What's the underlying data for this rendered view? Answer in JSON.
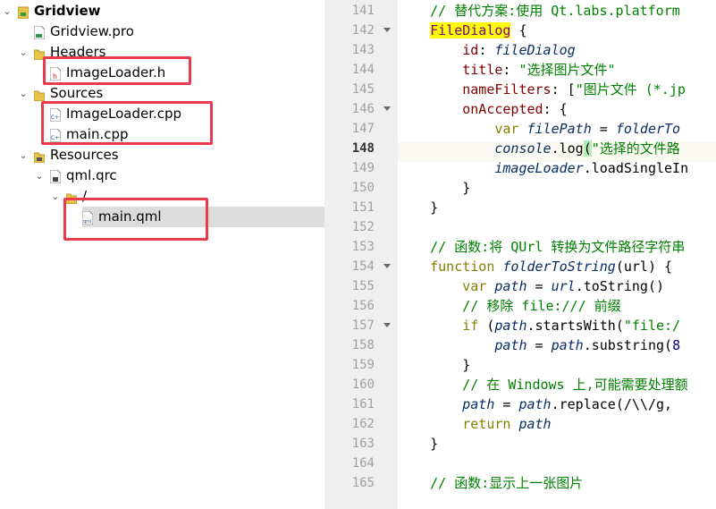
{
  "project_tree": {
    "items": [
      {
        "name": "tree-item-gridview",
        "label": "Gridview",
        "level": 0,
        "expanded": true,
        "icon": "project-folder-icon",
        "bold": true
      },
      {
        "name": "tree-item-gridview-pro",
        "label": "Gridview.pro",
        "level": 1,
        "expanded": null,
        "icon": "pro-file-icon"
      },
      {
        "name": "tree-item-headers",
        "label": "Headers",
        "level": 1,
        "expanded": true,
        "icon": "folder-icon"
      },
      {
        "name": "tree-item-imageloader-h",
        "label": "ImageLoader.h",
        "level": 2,
        "expanded": null,
        "icon": "header-file-icon"
      },
      {
        "name": "tree-item-sources",
        "label": "Sources",
        "level": 1,
        "expanded": true,
        "icon": "folder-icon"
      },
      {
        "name": "tree-item-imageloader-cpp",
        "label": "ImageLoader.cpp",
        "level": 2,
        "expanded": null,
        "icon": "cpp-file-icon"
      },
      {
        "name": "tree-item-main-cpp",
        "label": "main.cpp",
        "level": 2,
        "expanded": null,
        "icon": "cpp-file-icon"
      },
      {
        "name": "tree-item-resources",
        "label": "Resources",
        "level": 1,
        "expanded": true,
        "icon": "resource-folder-icon"
      },
      {
        "name": "tree-item-qml-qrc",
        "label": "qml.qrc",
        "level": 2,
        "expanded": true,
        "icon": "qrc-file-icon"
      },
      {
        "name": "tree-item-root-prefix",
        "label": "/",
        "level": 3,
        "expanded": true,
        "icon": "folder-icon"
      },
      {
        "name": "tree-item-main-qml",
        "label": "main.qml",
        "level": 4,
        "expanded": null,
        "icon": "qml-file-icon",
        "selected": true
      }
    ]
  },
  "editor": {
    "current_line": 148,
    "lines": [
      {
        "num": 141,
        "fold": false,
        "code": [
          {
            "t": "    // 替代方案:使用 Qt.labs.platform",
            "c": "cm"
          }
        ]
      },
      {
        "num": 142,
        "fold": true,
        "code": [
          {
            "t": "    "
          },
          {
            "t": "FileDialog",
            "c": "ty hlword"
          },
          {
            "t": " {"
          }
        ]
      },
      {
        "num": 143,
        "fold": false,
        "code": [
          {
            "t": "        "
          },
          {
            "t": "id",
            "c": "prop"
          },
          {
            "t": ": "
          },
          {
            "t": "fileDialog",
            "c": "id"
          }
        ]
      },
      {
        "num": 144,
        "fold": false,
        "code": [
          {
            "t": "        "
          },
          {
            "t": "title",
            "c": "prop"
          },
          {
            "t": ": "
          },
          {
            "t": "\"选择图片文件\"",
            "c": "str"
          }
        ]
      },
      {
        "num": 145,
        "fold": false,
        "code": [
          {
            "t": "        "
          },
          {
            "t": "nameFilters",
            "c": "prop"
          },
          {
            "t": ": ["
          },
          {
            "t": "\"图片文件 (*.jp",
            "c": "str"
          }
        ]
      },
      {
        "num": 146,
        "fold": true,
        "code": [
          {
            "t": "        "
          },
          {
            "t": "onAccepted",
            "c": "prop"
          },
          {
            "t": ": {"
          }
        ]
      },
      {
        "num": 147,
        "fold": false,
        "code": [
          {
            "t": "            "
          },
          {
            "t": "var",
            "c": "kw"
          },
          {
            "t": " "
          },
          {
            "t": "filePath",
            "c": "id"
          },
          {
            "t": " = "
          },
          {
            "t": "folderTo",
            "c": "id"
          }
        ]
      },
      {
        "num": 148,
        "fold": false,
        "code": [
          {
            "t": "            "
          },
          {
            "t": "console",
            "c": "id"
          },
          {
            "t": ".log"
          },
          {
            "t": "(",
            "c": "bm"
          },
          {
            "t": "\"选择的文件路",
            "c": "str"
          }
        ]
      },
      {
        "num": 149,
        "fold": false,
        "code": [
          {
            "t": "            "
          },
          {
            "t": "imageLoader",
            "c": "id"
          },
          {
            "t": ".loadSingleIn"
          }
        ]
      },
      {
        "num": 150,
        "fold": false,
        "code": [
          {
            "t": "        }"
          }
        ]
      },
      {
        "num": 151,
        "fold": false,
        "code": [
          {
            "t": "    }"
          }
        ]
      },
      {
        "num": 152,
        "fold": false,
        "code": [
          {
            "t": ""
          }
        ]
      },
      {
        "num": 153,
        "fold": false,
        "code": [
          {
            "t": "    // 函数:将 QUrl 转换为文件路径字符串",
            "c": "cm"
          }
        ]
      },
      {
        "num": 154,
        "fold": true,
        "code": [
          {
            "t": "    "
          },
          {
            "t": "function",
            "c": "kw"
          },
          {
            "t": " "
          },
          {
            "t": "folderToString",
            "c": "id"
          },
          {
            "t": "(url) {"
          }
        ]
      },
      {
        "num": 155,
        "fold": false,
        "code": [
          {
            "t": "        "
          },
          {
            "t": "var",
            "c": "kw"
          },
          {
            "t": " "
          },
          {
            "t": "path",
            "c": "id"
          },
          {
            "t": " = "
          },
          {
            "t": "url",
            "c": "id"
          },
          {
            "t": ".toString()"
          }
        ]
      },
      {
        "num": 156,
        "fold": false,
        "code": [
          {
            "t": "        // 移除 file:/// 前缀",
            "c": "cm"
          }
        ]
      },
      {
        "num": 157,
        "fold": true,
        "code": [
          {
            "t": "        "
          },
          {
            "t": "if",
            "c": "kw"
          },
          {
            "t": " ("
          },
          {
            "t": "path",
            "c": "id"
          },
          {
            "t": ".startsWith("
          },
          {
            "t": "\"file:/",
            "c": "str"
          }
        ]
      },
      {
        "num": 158,
        "fold": false,
        "code": [
          {
            "t": "            "
          },
          {
            "t": "path",
            "c": "id"
          },
          {
            "t": " = "
          },
          {
            "t": "path",
            "c": "id"
          },
          {
            "t": ".substring("
          },
          {
            "t": "8",
            "c": "num"
          }
        ]
      },
      {
        "num": 159,
        "fold": false,
        "code": [
          {
            "t": "        }"
          }
        ]
      },
      {
        "num": 160,
        "fold": false,
        "code": [
          {
            "t": "        // 在 Windows 上,可能需要处理额",
            "c": "cm"
          }
        ]
      },
      {
        "num": 161,
        "fold": false,
        "code": [
          {
            "t": "        "
          },
          {
            "t": "path",
            "c": "id"
          },
          {
            "t": " = "
          },
          {
            "t": "path",
            "c": "id"
          },
          {
            "t": ".replace(/\\\\/g,"
          }
        ]
      },
      {
        "num": 162,
        "fold": false,
        "code": [
          {
            "t": "        "
          },
          {
            "t": "return",
            "c": "kw"
          },
          {
            "t": " "
          },
          {
            "t": "path",
            "c": "id"
          }
        ]
      },
      {
        "num": 163,
        "fold": false,
        "code": [
          {
            "t": "    }"
          }
        ]
      },
      {
        "num": 164,
        "fold": false,
        "code": [
          {
            "t": ""
          }
        ]
      },
      {
        "num": 165,
        "fold": false,
        "code": [
          {
            "t": "    // 函数:显示上一张图片",
            "c": "cm"
          }
        ]
      }
    ]
  },
  "highlight_color": "#e83b4c"
}
